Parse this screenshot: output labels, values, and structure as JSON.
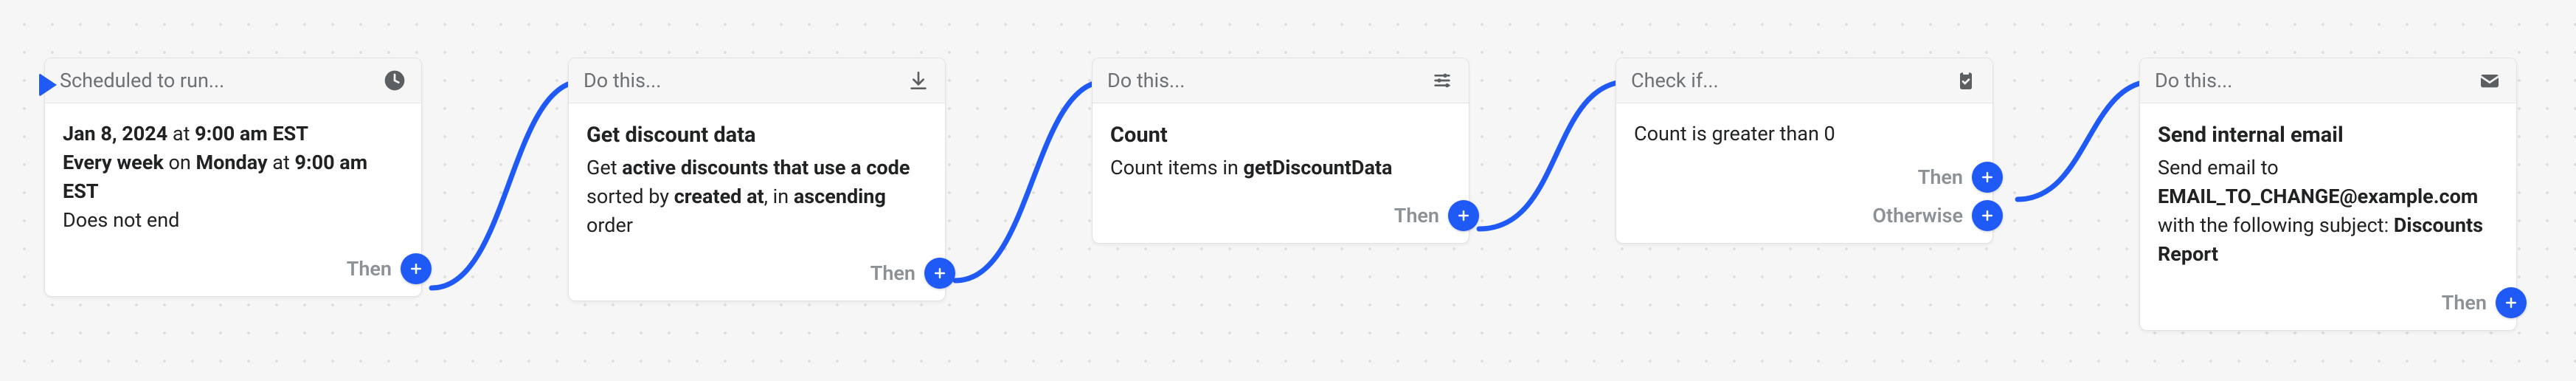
{
  "nodes": {
    "trigger": {
      "header": "Scheduled to run...",
      "body_html": "<div><b>Jan 8, 2024</b> at <b>9:00 am EST</b></div><div><b>Every week</b> on <b>Monday</b> at <b>9:00 am EST</b></div><div>Does not end</div>",
      "then": "Then"
    },
    "getDiscounts": {
      "header": "Do this...",
      "title": "Get discount data",
      "desc_html": "Get <b>active discounts that use a code</b> sorted by <b>created at</b>, in <b>ascending</b> order",
      "then": "Then"
    },
    "count": {
      "header": "Do this...",
      "title": "Count",
      "desc_html": "Count items in <b>getDiscountData</b>",
      "then": "Then"
    },
    "check": {
      "header": "Check if...",
      "desc": "Count is greater than 0",
      "then": "Then",
      "otherwise": "Otherwise"
    },
    "email": {
      "header": "Do this...",
      "title": "Send internal email",
      "desc_html": "Send email to <b>EMAIL_TO_CHANGE@example.com</b> with the following subject: <b>Discounts Report</b>",
      "then": "Then"
    }
  },
  "icons": {
    "clock": "clock-icon",
    "download": "download-icon",
    "settings": "settings-icon",
    "clipboard": "clipboard-icon",
    "mail": "mail-icon"
  }
}
